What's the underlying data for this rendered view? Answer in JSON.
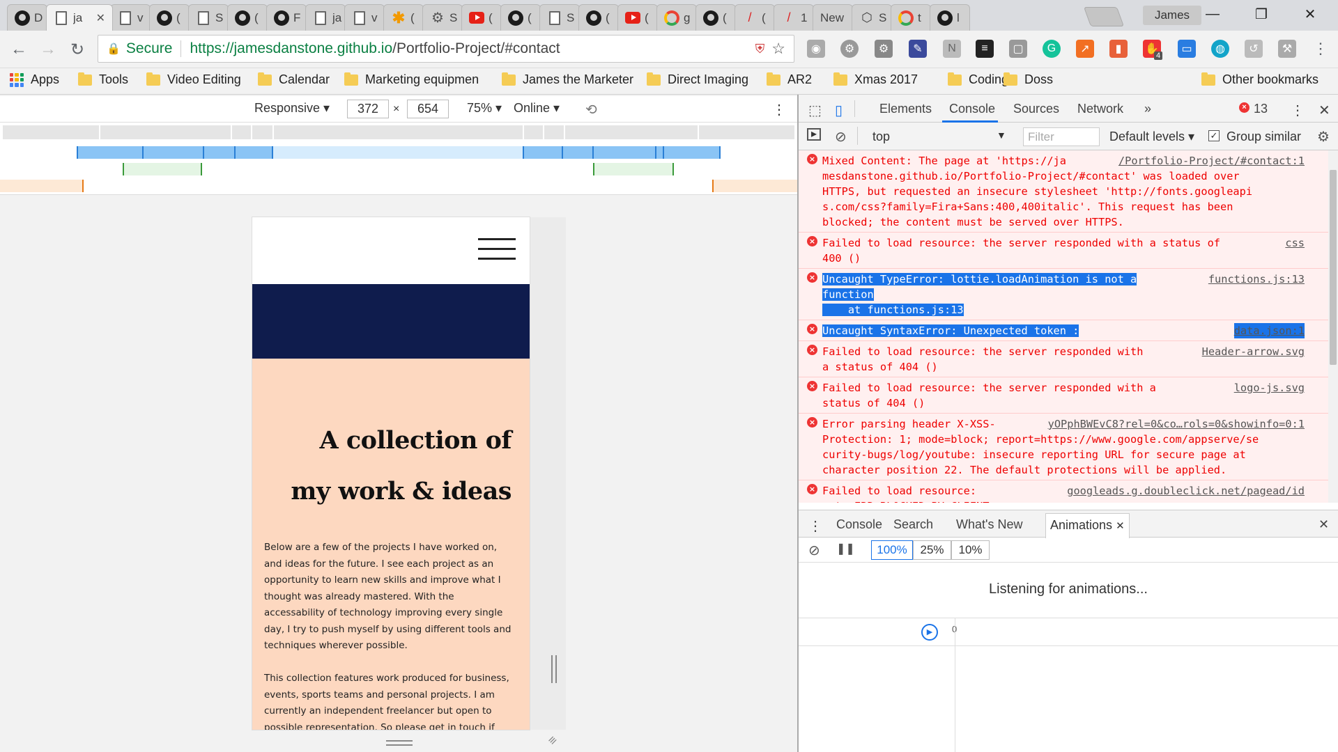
{
  "browser": {
    "tabs": [
      {
        "icon": "github-icon",
        "title": "D"
      },
      {
        "icon": "page-icon",
        "title": "ja",
        "active": true
      },
      {
        "icon": "page-icon",
        "title": "v"
      },
      {
        "icon": "github-icon",
        "title": "("
      },
      {
        "icon": "page-icon",
        "title": "S"
      },
      {
        "icon": "github-icon",
        "title": "("
      },
      {
        "icon": "github-icon",
        "title": "F"
      },
      {
        "icon": "page-icon",
        "title": "ja"
      },
      {
        "icon": "page-icon",
        "title": "v"
      },
      {
        "icon": "asterisk-icon",
        "title": "("
      },
      {
        "icon": "gear-icon",
        "title": "S"
      },
      {
        "icon": "youtube-icon",
        "title": "("
      },
      {
        "icon": "github-icon",
        "title": "("
      },
      {
        "icon": "page-icon",
        "title": "S"
      },
      {
        "icon": "github-icon",
        "title": "("
      },
      {
        "icon": "youtube-icon",
        "title": "("
      },
      {
        "icon": "google-icon",
        "title": "g"
      },
      {
        "icon": "github-icon",
        "title": "("
      },
      {
        "icon": "pen-icon",
        "title": "("
      },
      {
        "icon": "pen-icon",
        "title": "1"
      },
      {
        "icon": "none",
        "title": "New"
      },
      {
        "icon": "codepen-icon",
        "title": "S"
      },
      {
        "icon": "google-icon",
        "title": "t"
      },
      {
        "icon": "github-icon",
        "title": "l"
      }
    ],
    "close_glyph": "✕",
    "profile_name": "James",
    "window_controls": {
      "minimize": "—",
      "restore": "❐",
      "close": "✕"
    },
    "security_label": "Secure",
    "url_host": "https://jamesdanstone.github.io",
    "url_path": "/Portfolio-Project/#contact",
    "ext_badge": "4"
  },
  "bookmarks": [
    {
      "label": "Apps",
      "type": "apps"
    },
    {
      "label": "Tools"
    },
    {
      "label": "Video Editing"
    },
    {
      "label": "Calendar"
    },
    {
      "label": "Marketing equipmen"
    },
    {
      "label": "James the Marketer"
    },
    {
      "label": "Direct Imaging"
    },
    {
      "label": "AR2"
    },
    {
      "label": "Xmas 2017"
    },
    {
      "label": "Coding"
    },
    {
      "label": "Doss"
    }
  ],
  "other_bookmarks": "Other bookmarks",
  "device_toolbar": {
    "mode": "Responsive ▾",
    "width": "372",
    "times": "×",
    "height": "654",
    "zoom": "75% ▾",
    "network": "Online ▾"
  },
  "page": {
    "heading_line1": "A collection of",
    "heading_line2": "my work & ideas",
    "para1_lines": [
      "Below are a few of the projects I have worked on,",
      "and ideas for the future. I see each project as an",
      "opportunity to learn new skills and improve what I",
      "thought was already mastered. With the",
      "accessability of technology improving every single",
      "day, I try to push myself by using different tools and",
      "techniques wherever possible."
    ],
    "para2_lines": [
      "This collection features work produced for business,",
      "events, sports teams and personal projects. I am",
      "currently an independent freelancer but open to",
      "possible representation. So please get in touch if"
    ]
  },
  "devtools": {
    "tabs": [
      "Elements",
      "Console",
      "Sources",
      "Network"
    ],
    "more": "»",
    "error_count": "13",
    "context": "top",
    "filter_placeholder": "Filter",
    "levels": "Default levels ▾",
    "group_similar": "Group similar",
    "messages": [
      {
        "lines": [
          "Mixed Content: The page at 'https://ja",
          "mesdanstone.github.io/Portfolio-Project/#contact' was loaded over",
          "HTTPS, but requested an insecure stylesheet 'http://fonts.googleapi",
          "s.com/css?family=Fira+Sans:400,400italic'. This request has been",
          "blocked; the content must be served over HTTPS."
        ],
        "source": "/Portfolio-Project/#contact:1"
      },
      {
        "lines": [
          "Failed to load resource: the server responded with a status of",
          "400 ()"
        ],
        "source": "css"
      },
      {
        "lines": [
          "Uncaught TypeError: lottie.loadAnimation is not a",
          "function",
          "    at functions.js:13"
        ],
        "source": "functions.js:13"
      },
      {
        "lines": [
          "Uncaught SyntaxError: Unexpected token :"
        ],
        "source": "data.json:1"
      },
      {
        "lines": [
          "Failed to load resource: the server responded with",
          "a status of 404 ()"
        ],
        "source": "Header-arrow.svg"
      },
      {
        "lines": [
          "Failed to load resource: the server responded with a",
          "status of 404 ()"
        ],
        "source": "logo-js.svg"
      },
      {
        "lines": [
          "Error parsing header X-XSS-",
          "Protection: 1; mode=block; report=https://www.google.com/appserve/se",
          "curity-bugs/log/youtube: insecure reporting URL for secure page at",
          "character position 22. The default protections will be applied."
        ],
        "source": "yOPphBWEvC8?rel=0&co…rols=0&showinfo=0:1"
      },
      {
        "lines": [
          "Failed to load resource:",
          "net::ERR_BLOCKED_BY_CLIENT"
        ],
        "source": "googleads.g.doubleclick.net/pagead/id"
      }
    ],
    "drawer_tabs": [
      "Console",
      "Search",
      "What's New",
      "Animations"
    ],
    "speeds": [
      "100%",
      "25%",
      "10%"
    ],
    "listening": "Listening for animations...",
    "timeline_zero": "0"
  }
}
